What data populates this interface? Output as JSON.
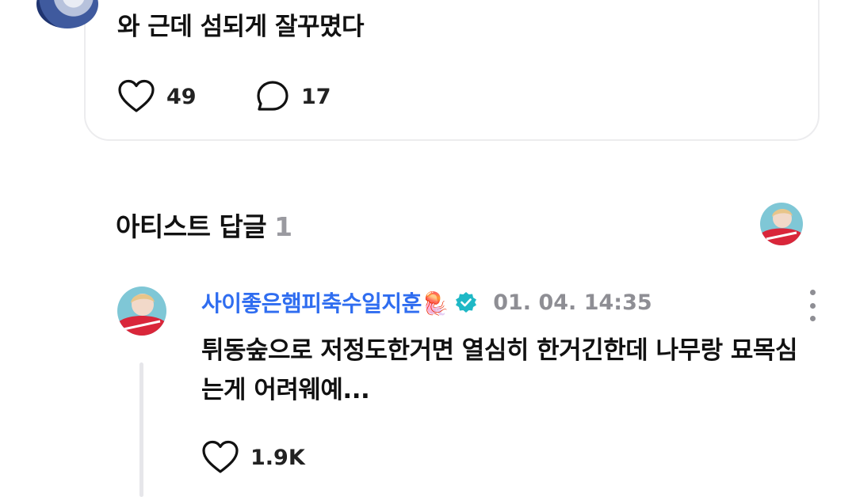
{
  "post": {
    "text": "와 근데 섬되게 잘꾸몄다",
    "likes": "49",
    "comments": "17"
  },
  "artist_replies": {
    "title": "아티스트 답글",
    "count": "1"
  },
  "reply": {
    "author": "사이좋은햄피축수일지훈🪼",
    "timestamp": "01. 04. 14:35",
    "body": "튀동숲으로 저정도한거면 열심히 한거긴한데 나무랑 묘목심는게 어려웨예...",
    "likes": "1.9K"
  },
  "colors": {
    "author_link": "#2f6df0",
    "verified_badge": "#1fb8c6",
    "muted": "#8e8e94"
  }
}
